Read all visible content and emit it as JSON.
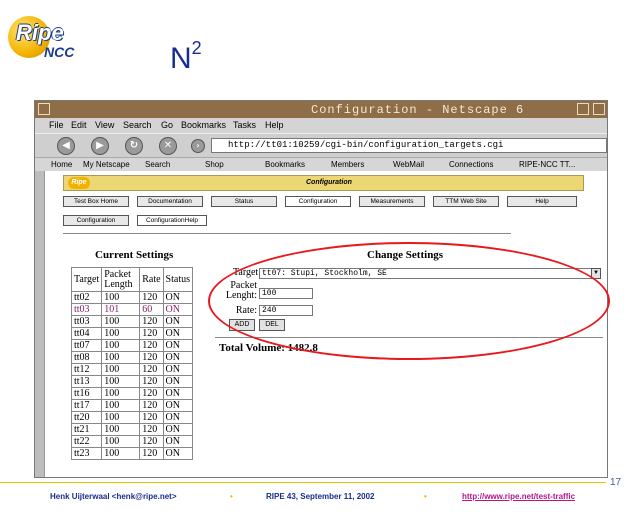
{
  "slide": {
    "logo_text": "Ripe",
    "logo_sub": "NCC",
    "title": "N",
    "title_sup": "2",
    "page_number": "17"
  },
  "browser": {
    "window_title": "Configuration - Netscape 6",
    "menu": [
      "File",
      "Edit",
      "View",
      "Search",
      "Go",
      "Bookmarks",
      "Tasks",
      "Help"
    ],
    "url": "http://tt01:10259/cgi-bin/configuration_targets.cgi",
    "personal_toolbar": [
      "Home",
      "My Netscape",
      "Search",
      "Shop",
      "Bookmarks",
      "Members",
      "WebMail",
      "Connections",
      "RIPE-NCC TT..."
    ]
  },
  "page": {
    "header_logo": "Ripe",
    "header_label": "Configuration",
    "tabs": [
      "Test Box Home",
      "Documentation",
      "Status",
      "Configuration",
      "Measurements",
      "TTM Web Site",
      "Help"
    ],
    "subtabs": [
      "Configuration",
      "ConfigurationHelp"
    ],
    "current_settings": {
      "title": "Current Settings",
      "headers": [
        "Target",
        "Packet Length",
        "Rate",
        "Status"
      ],
      "rows": [
        [
          "tt02",
          "100",
          "120",
          "ON"
        ],
        [
          "tt03",
          "101",
          "60",
          "ON"
        ],
        [
          "tt03",
          "100",
          "120",
          "ON"
        ],
        [
          "tt04",
          "100",
          "120",
          "ON"
        ],
        [
          "tt07",
          "100",
          "120",
          "ON"
        ],
        [
          "tt08",
          "100",
          "120",
          "ON"
        ],
        [
          "tt12",
          "100",
          "120",
          "ON"
        ],
        [
          "tt13",
          "100",
          "120",
          "ON"
        ],
        [
          "tt16",
          "100",
          "120",
          "ON"
        ],
        [
          "tt17",
          "100",
          "120",
          "ON"
        ],
        [
          "tt20",
          "100",
          "120",
          "ON"
        ],
        [
          "tt21",
          "100",
          "120",
          "ON"
        ],
        [
          "tt22",
          "100",
          "120",
          "ON"
        ],
        [
          "tt23",
          "100",
          "120",
          "ON"
        ]
      ]
    },
    "change_settings": {
      "title": "Change Settings",
      "target_label": "Target:",
      "target_value": "tt07: Stupi, Stockholm, SE",
      "packet_label_1": "Packet",
      "packet_label_2": "Lenght:",
      "packet_value": "100",
      "rate_label": "Rate:",
      "rate_value": "240",
      "add_label": "ADD",
      "del_label": "DEL"
    },
    "total_volume": "Total Volume: 1482.8"
  },
  "footer": {
    "author": "Henk Uijterwaal <henk@ripe.net>",
    "event": "RIPE 43, September 11, 2002",
    "link": "http://www.ripe.net/test-traffic"
  },
  "colors": {
    "title_blue": "#1a2c8c",
    "titlebar_brown": "#8f6d46",
    "header_yellow": "#ecd774",
    "annotation_red": "#e8191e",
    "link_magenta": "#b2168c",
    "highlight_row": "#8a1a6a"
  }
}
